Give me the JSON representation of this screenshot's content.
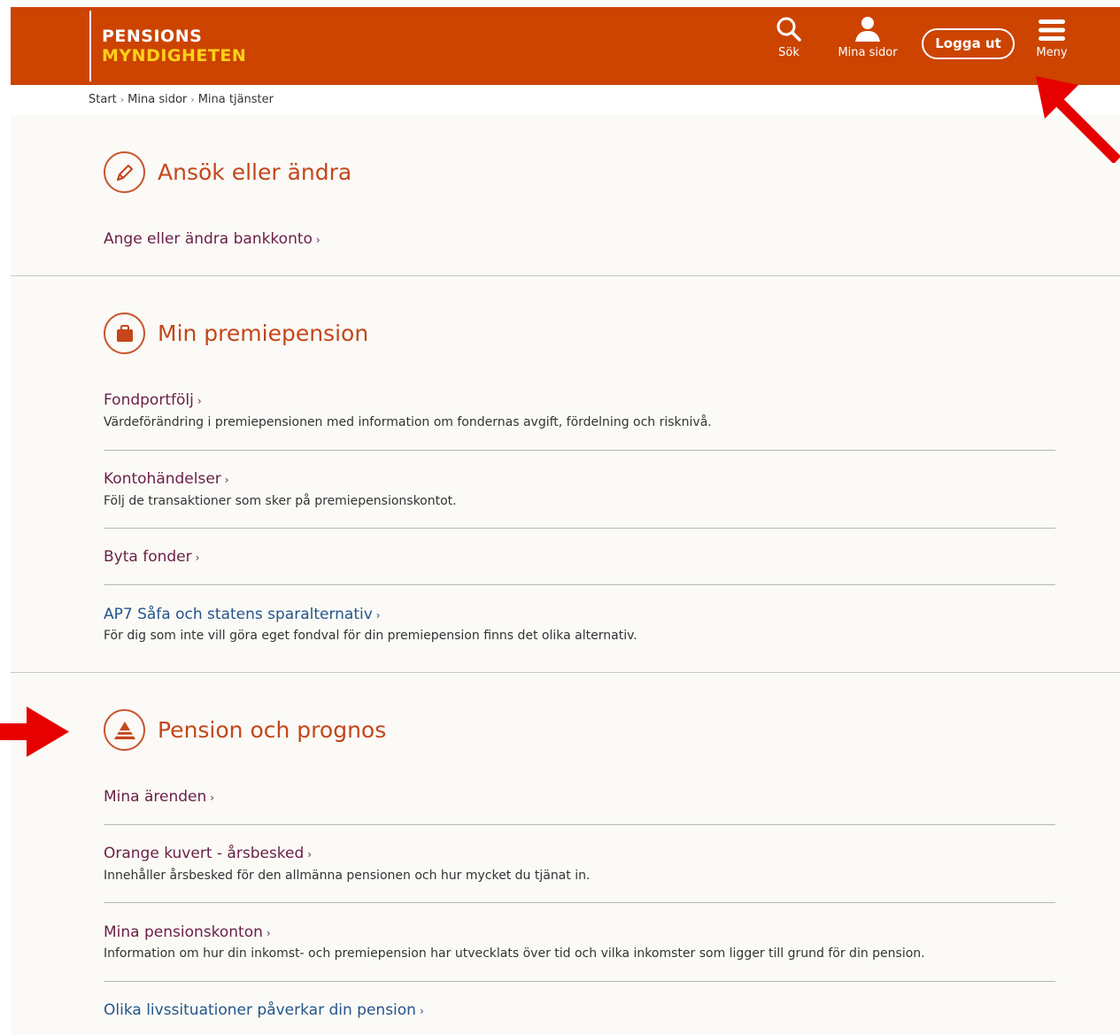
{
  "header": {
    "logo_line1": "PENSIONS",
    "logo_line2": "MYNDIGHETEN",
    "search_label": "Sök",
    "mine_label": "Mina sidor",
    "logout_label": "Logga ut",
    "menu_label": "Meny",
    "bg_color": "#cc4400"
  },
  "breadcrumb": {
    "items": [
      "Start",
      "Mina sidor",
      "Mina tjänster"
    ],
    "separator": "›"
  },
  "chevron": "›",
  "sections": [
    {
      "title": "Ansök eller ändra",
      "icon": "pencil-icon",
      "links": [
        {
          "label": "Ange eller ändra bankkonto",
          "desc": ""
        }
      ]
    },
    {
      "title": "Min premiepension",
      "icon": "briefcase-icon",
      "links": [
        {
          "label": "Fondportfölj",
          "desc": "Värdeförändring i premiepensionen med information om fondernas avgift, fördelning och risknivå."
        },
        {
          "label": "Kontohändelser",
          "desc": "Följ de transaktioner som sker på premiepensionskontot."
        },
        {
          "label": "Byta fonder",
          "desc": ""
        },
        {
          "label": "AP7 Såfa och statens sparalternativ",
          "desc": "För dig som inte vill göra eget fondval för din premiepension finns det olika alternativ."
        }
      ]
    },
    {
      "title": "Pension och prognos",
      "icon": "pyramid-icon",
      "links": [
        {
          "label": "Mina ärenden",
          "desc": ""
        },
        {
          "label": "Orange kuvert - årsbesked",
          "desc": "Innehåller årsbesked för den allmänna pensionen och hur mycket du tjänat in."
        },
        {
          "label": "Mina pensionskonton",
          "desc": "Information om hur din inkomst- och premiepension har utvecklats över tid och vilka inkomster som ligger till grund för din pension."
        },
        {
          "label": "Olika livssituationer påverkar din pension",
          "desc": ""
        }
      ]
    }
  ],
  "colors": {
    "accent": "#c4461a",
    "link": "#6a1f45",
    "link_blue": "#24558a",
    "annotation_arrow": "#e60000"
  }
}
